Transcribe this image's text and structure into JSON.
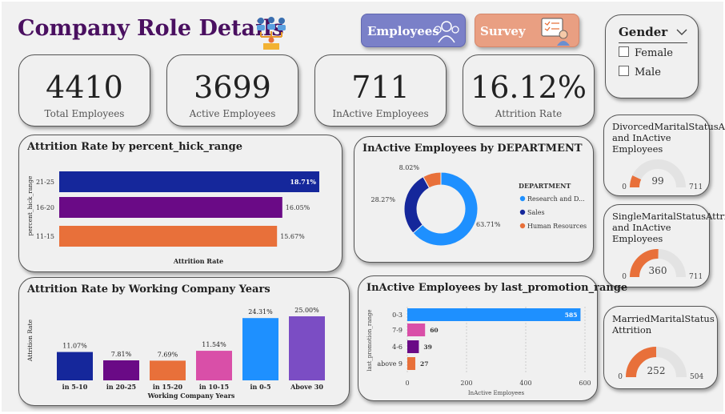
{
  "header": {
    "title": "Company Role Details"
  },
  "nav": {
    "employees_label": "Employees",
    "survey_label": "Survey"
  },
  "kpis": [
    {
      "value": "4410",
      "label": "Total Employees"
    },
    {
      "value": "3699",
      "label": "Active Employees"
    },
    {
      "value": "711",
      "label": "InActive Employees"
    },
    {
      "value": "16.12%",
      "label": "Attrition Rate"
    }
  ],
  "slicer": {
    "title": "Gender",
    "options": [
      "Female",
      "Male"
    ]
  },
  "gauges": [
    {
      "title": "DivorcedMaritalStatusAttrition and InActive Employees",
      "value": 99,
      "min": "0",
      "max": "711",
      "value_label": "99"
    },
    {
      "title": "SingleMaritalStatusAttrition and InActive Employees",
      "value": 360,
      "min": "0",
      "max": "711",
      "value_label": "360"
    },
    {
      "title": "MarriedMaritalStatus Attrition",
      "value": 252,
      "min": "0",
      "max": "504",
      "value_label": "252"
    }
  ],
  "colors": {
    "blue": "#1e90ff",
    "navy": "#15279b",
    "purple": "#6a0a86",
    "orange": "#e8703a",
    "pink": "#d94fa8",
    "violet": "#7b4dc4",
    "title": "#4a1060"
  },
  "chart_data": [
    {
      "type": "bar",
      "orientation": "horizontal",
      "title": "Attrition Rate by percent_hick_range",
      "xlabel": "Attrition Rate",
      "ylabel": "percent_hick_range",
      "categories": [
        "21-25",
        "16-20",
        "11-15"
      ],
      "values": [
        18.71,
        16.05,
        15.67
      ],
      "data_labels": [
        "18.71%",
        "16.05%",
        "15.67%"
      ],
      "colors": [
        "#15279b",
        "#6a0a86",
        "#e8703a"
      ]
    },
    {
      "type": "pie",
      "title": "InActive Employees by DEPARTMENT",
      "legend_title": "DEPARTMENT",
      "legend_position": "right",
      "labels": [
        "Research and D...",
        "Sales",
        "Human Resources"
      ],
      "values": [
        63.71,
        28.27,
        8.02
      ],
      "data_labels": [
        "63.71%",
        "28.27%",
        "8.02%"
      ],
      "colors": [
        "#1e90ff",
        "#15279b",
        "#e8703a"
      ]
    },
    {
      "type": "bar",
      "title": "Attrition Rate by Working Company Years",
      "xlabel": "Working Company Years",
      "ylabel": "Attrition Rate",
      "categories": [
        "in 5-10",
        "in 20-25",
        "in 15-20",
        "in 10-15",
        "in 0-5",
        "Above 30"
      ],
      "values": [
        11.07,
        7.81,
        7.69,
        11.54,
        24.31,
        25.0
      ],
      "data_labels": [
        "11.07%",
        "7.81%",
        "7.69%",
        "11.54%",
        "24.31%",
        "25.00%"
      ],
      "colors": [
        "#15279b",
        "#6a0a86",
        "#e8703a",
        "#d94fa8",
        "#1e90ff",
        "#7b4dc4"
      ]
    },
    {
      "type": "bar",
      "orientation": "horizontal",
      "title": "InActive Employees by last_promotion_range",
      "xlabel": "InActive Employees",
      "ylabel": "last_promotion_range",
      "categories": [
        "0-3",
        "7-9",
        "4-6",
        "above 9"
      ],
      "values": [
        585,
        60,
        39,
        27
      ],
      "xlim": [
        0,
        600
      ],
      "xticks": [
        "0",
        "200",
        "400",
        "600"
      ],
      "grid": true,
      "colors": [
        "#1e90ff",
        "#d94fa8",
        "#6a0a86",
        "#e8703a"
      ]
    }
  ]
}
